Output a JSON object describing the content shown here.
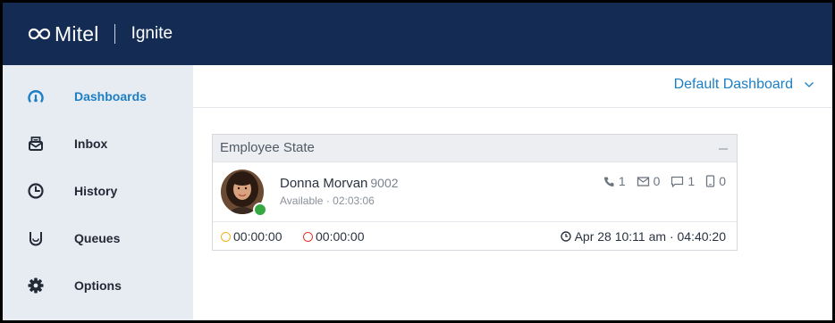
{
  "header": {
    "brand_name": "Mitel",
    "product_name": "Ignite"
  },
  "sidebar": {
    "items": [
      {
        "label": "Dashboards",
        "icon": "gauge-icon",
        "active": true
      },
      {
        "label": "Inbox",
        "icon": "inbox-icon",
        "active": false
      },
      {
        "label": "History",
        "icon": "clock-icon",
        "active": false
      },
      {
        "label": "Queues",
        "icon": "queue-icon",
        "active": false
      },
      {
        "label": "Options",
        "icon": "gear-icon",
        "active": false
      }
    ]
  },
  "dashboard": {
    "selected": "Default Dashboard"
  },
  "widget": {
    "title": "Employee State",
    "employee": {
      "name": "Donna Morvan",
      "extension": "9002",
      "status": "Available · 02:03:06",
      "status_color": "#35a844",
      "counts": {
        "calls": "1",
        "emails": "0",
        "chats": "1",
        "sms": "0"
      }
    },
    "timers": {
      "yellow": "00:00:00",
      "red": "00:00:00"
    },
    "login": "Apr 28 10:11 am · 04:40:20"
  },
  "colors": {
    "topbar": "#142c54",
    "sidebar": "#e7ebf2",
    "accent": "#1c7fc4",
    "timer_yellow": "#f2b01e",
    "timer_red": "#e2372f"
  }
}
